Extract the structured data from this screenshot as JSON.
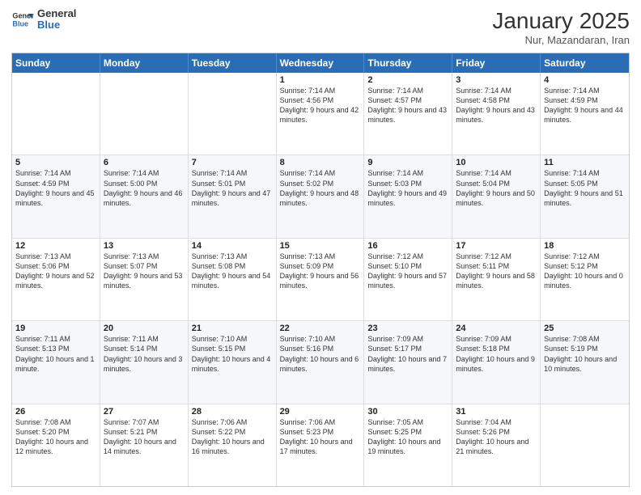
{
  "logo": {
    "line1": "General",
    "line2": "Blue"
  },
  "calendar": {
    "title": "January 2025",
    "subtitle": "Nur, Mazandaran, Iran",
    "weekdays": [
      "Sunday",
      "Monday",
      "Tuesday",
      "Wednesday",
      "Thursday",
      "Friday",
      "Saturday"
    ],
    "rows": [
      [
        {
          "day": "",
          "info": ""
        },
        {
          "day": "",
          "info": ""
        },
        {
          "day": "",
          "info": ""
        },
        {
          "day": "1",
          "info": "Sunrise: 7:14 AM\nSunset: 4:56 PM\nDaylight: 9 hours and 42 minutes."
        },
        {
          "day": "2",
          "info": "Sunrise: 7:14 AM\nSunset: 4:57 PM\nDaylight: 9 hours and 43 minutes."
        },
        {
          "day": "3",
          "info": "Sunrise: 7:14 AM\nSunset: 4:58 PM\nDaylight: 9 hours and 43 minutes."
        },
        {
          "day": "4",
          "info": "Sunrise: 7:14 AM\nSunset: 4:59 PM\nDaylight: 9 hours and 44 minutes."
        }
      ],
      [
        {
          "day": "5",
          "info": "Sunrise: 7:14 AM\nSunset: 4:59 PM\nDaylight: 9 hours and 45 minutes."
        },
        {
          "day": "6",
          "info": "Sunrise: 7:14 AM\nSunset: 5:00 PM\nDaylight: 9 hours and 46 minutes."
        },
        {
          "day": "7",
          "info": "Sunrise: 7:14 AM\nSunset: 5:01 PM\nDaylight: 9 hours and 47 minutes."
        },
        {
          "day": "8",
          "info": "Sunrise: 7:14 AM\nSunset: 5:02 PM\nDaylight: 9 hours and 48 minutes."
        },
        {
          "day": "9",
          "info": "Sunrise: 7:14 AM\nSunset: 5:03 PM\nDaylight: 9 hours and 49 minutes."
        },
        {
          "day": "10",
          "info": "Sunrise: 7:14 AM\nSunset: 5:04 PM\nDaylight: 9 hours and 50 minutes."
        },
        {
          "day": "11",
          "info": "Sunrise: 7:14 AM\nSunset: 5:05 PM\nDaylight: 9 hours and 51 minutes."
        }
      ],
      [
        {
          "day": "12",
          "info": "Sunrise: 7:13 AM\nSunset: 5:06 PM\nDaylight: 9 hours and 52 minutes."
        },
        {
          "day": "13",
          "info": "Sunrise: 7:13 AM\nSunset: 5:07 PM\nDaylight: 9 hours and 53 minutes."
        },
        {
          "day": "14",
          "info": "Sunrise: 7:13 AM\nSunset: 5:08 PM\nDaylight: 9 hours and 54 minutes."
        },
        {
          "day": "15",
          "info": "Sunrise: 7:13 AM\nSunset: 5:09 PM\nDaylight: 9 hours and 56 minutes."
        },
        {
          "day": "16",
          "info": "Sunrise: 7:12 AM\nSunset: 5:10 PM\nDaylight: 9 hours and 57 minutes."
        },
        {
          "day": "17",
          "info": "Sunrise: 7:12 AM\nSunset: 5:11 PM\nDaylight: 9 hours and 58 minutes."
        },
        {
          "day": "18",
          "info": "Sunrise: 7:12 AM\nSunset: 5:12 PM\nDaylight: 10 hours and 0 minutes."
        }
      ],
      [
        {
          "day": "19",
          "info": "Sunrise: 7:11 AM\nSunset: 5:13 PM\nDaylight: 10 hours and 1 minute."
        },
        {
          "day": "20",
          "info": "Sunrise: 7:11 AM\nSunset: 5:14 PM\nDaylight: 10 hours and 3 minutes."
        },
        {
          "day": "21",
          "info": "Sunrise: 7:10 AM\nSunset: 5:15 PM\nDaylight: 10 hours and 4 minutes."
        },
        {
          "day": "22",
          "info": "Sunrise: 7:10 AM\nSunset: 5:16 PM\nDaylight: 10 hours and 6 minutes."
        },
        {
          "day": "23",
          "info": "Sunrise: 7:09 AM\nSunset: 5:17 PM\nDaylight: 10 hours and 7 minutes."
        },
        {
          "day": "24",
          "info": "Sunrise: 7:09 AM\nSunset: 5:18 PM\nDaylight: 10 hours and 9 minutes."
        },
        {
          "day": "25",
          "info": "Sunrise: 7:08 AM\nSunset: 5:19 PM\nDaylight: 10 hours and 10 minutes."
        }
      ],
      [
        {
          "day": "26",
          "info": "Sunrise: 7:08 AM\nSunset: 5:20 PM\nDaylight: 10 hours and 12 minutes."
        },
        {
          "day": "27",
          "info": "Sunrise: 7:07 AM\nSunset: 5:21 PM\nDaylight: 10 hours and 14 minutes."
        },
        {
          "day": "28",
          "info": "Sunrise: 7:06 AM\nSunset: 5:22 PM\nDaylight: 10 hours and 16 minutes."
        },
        {
          "day": "29",
          "info": "Sunrise: 7:06 AM\nSunset: 5:23 PM\nDaylight: 10 hours and 17 minutes."
        },
        {
          "day": "30",
          "info": "Sunrise: 7:05 AM\nSunset: 5:25 PM\nDaylight: 10 hours and 19 minutes."
        },
        {
          "day": "31",
          "info": "Sunrise: 7:04 AM\nSunset: 5:26 PM\nDaylight: 10 hours and 21 minutes."
        },
        {
          "day": "",
          "info": ""
        }
      ]
    ]
  }
}
